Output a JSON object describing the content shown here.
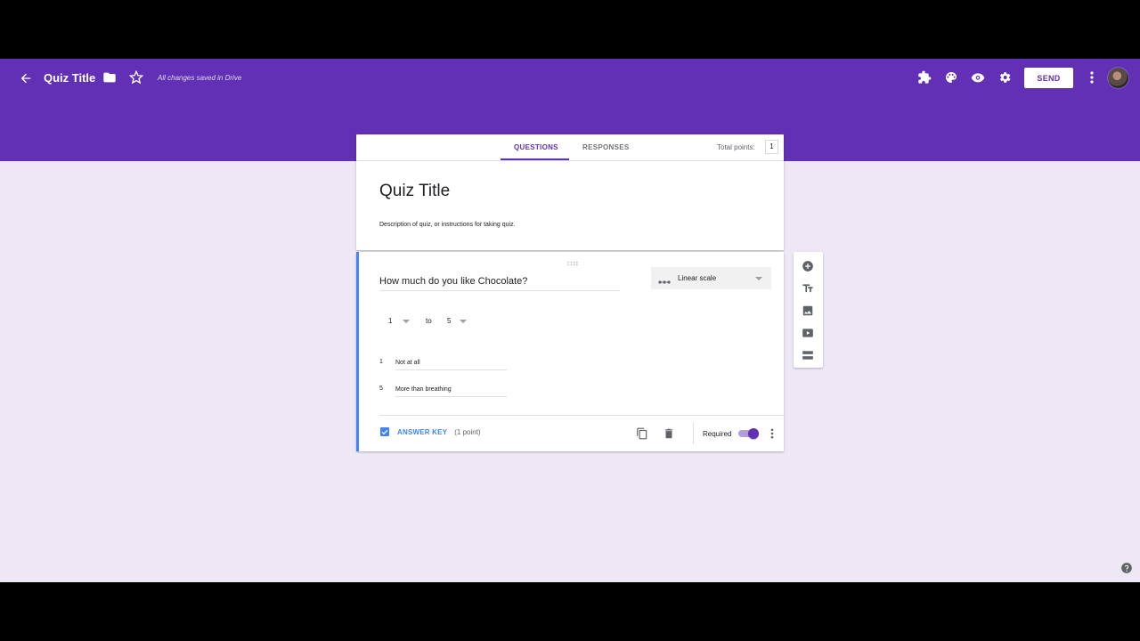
{
  "toolbar": {
    "title": "Quiz Title",
    "save_status": "All changes saved in Drive",
    "send_label": "SEND",
    "icons": [
      "back-arrow-icon",
      "folder-icon",
      "star-icon",
      "addons-puzzle-icon",
      "palette-icon",
      "preview-eye-icon",
      "settings-gear-icon",
      "more-vert-icon",
      "avatar"
    ]
  },
  "tabs": [
    {
      "label": "QUESTIONS",
      "active": true
    },
    {
      "label": "RESPONSES",
      "active": false
    }
  ],
  "total_points": {
    "label": "Total points:",
    "value": "1"
  },
  "form": {
    "title": "Quiz Title",
    "description": "Description of quiz, or instructions for taking quiz."
  },
  "question": {
    "title": "How much do you like Chocolate?",
    "type": "Linear scale",
    "range": {
      "min": "1",
      "to": "to",
      "max": "5"
    },
    "labels": [
      {
        "num": "1",
        "text": "Not at all"
      },
      {
        "num": "5",
        "text": "More than breathing"
      }
    ],
    "answer_key_label": "ANSWER KEY",
    "points": "(1 point)",
    "required_label": "Required",
    "required": true
  },
  "side_toolbar": [
    "add-question-icon",
    "add-title-icon",
    "add-image-icon",
    "add-video-icon",
    "add-section-icon"
  ],
  "colors": {
    "header": "#6130b4",
    "background": "#ede7f6",
    "accent_blue": "#4285f4"
  }
}
